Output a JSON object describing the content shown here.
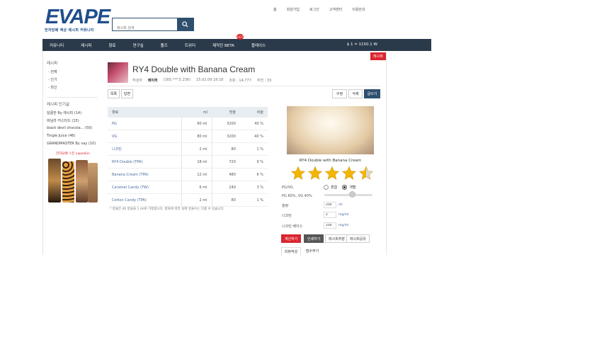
{
  "header": {
    "logo": "EVAPE",
    "logo_sub": "전자담배 액상 레시피 커뮤니티",
    "search_placeholder": "레시피 검색",
    "top_links": [
      "홈",
      "회원가입",
      "로그인",
      "고객센터",
      "이용안내"
    ]
  },
  "nav": {
    "items": [
      "커뮤니티",
      "레시피",
      "향료",
      "연구실",
      "툴즈",
      "트위터",
      "제작진 BETA",
      "플레이스"
    ],
    "hot_badge": "HOT",
    "right_text": "$ 1 = 1150.1 W"
  },
  "badge": "레시피",
  "sidebar": {
    "section1_title": "레시피",
    "section1_items": [
      "- 전체",
      "- 인기",
      "- 최신"
    ],
    "section2_title": "레시피 인기글",
    "section2_items": [
      "달콤한 By 레시피 (14)",
      "바닐라 커스터드 (15)",
      "black devil chocola... (50)",
      "Tingle Juice (46)",
      "GRANDMASTER By vay (10)"
    ],
    "ad_text": "전자담배 스킨 vapeskin"
  },
  "recipe": {
    "title": "RY4 Double with Banana Cream",
    "author_label": "작성자",
    "author": "베이퍼",
    "author_id": "(165.***.5.236)",
    "date": "15.02.09 18:18",
    "views": "조회 : 14,777",
    "recommend": "추천 : 33"
  },
  "buttons": {
    "list": "목록",
    "reply": "답변",
    "edit": "수정",
    "delete": "삭제",
    "write": "글쓰기"
  },
  "table": {
    "headers": [
      "향료",
      "ml",
      "방울",
      "비율"
    ],
    "rows": [
      [
        "PG",
        "80 ml",
        "3200",
        "40 %"
      ],
      [
        "VG",
        "80 ml",
        "3200",
        "40 %"
      ],
      [
        "니코틴",
        "2 ml",
        "80",
        "1 %"
      ],
      [
        "RY4 Double (TPA)",
        "18 ml",
        "720",
        "9 %"
      ],
      [
        "Banana Cream (TPA)",
        "12 ml",
        "480",
        "6 %"
      ],
      [
        "Caramel Candy (TW)",
        "6 ml",
        "240",
        "3 %"
      ],
      [
        "Cotton Candy (TPA)",
        "2 ml",
        "80",
        "1 %"
      ]
    ],
    "notice": "* 방울은 40 방울을 1 ml로 가정합니다. 향료에 따라 실제 방울수는 다를 수 있습니다."
  },
  "panel": {
    "photo_name": "RY4 Double with Banana Cream",
    "rating": 4.5,
    "pgvg_label": "PG/VG",
    "radio1": "혼합",
    "radio2": "개별",
    "pgvg_value": "PG 60%, VG 40%",
    "amount_label": "총량",
    "amount_value": "200",
    "amount_unit": "ml",
    "nic_label": "니코틴",
    "nic_value": "2",
    "nic_unit": "mg/ml",
    "nic_base_label": "니코틴 베이스",
    "nic_base_value": "100",
    "nic_base_unit": "mg/ml",
    "btn1": "계산하기",
    "btn2": "인쇄하기",
    "btn3": "레시피저장",
    "btn4": "레시피공유",
    "link1": "리뷰작성",
    "link2": "점수주기"
  },
  "colors": {
    "navbar": "#2b3a4a",
    "accent": "#2f4f6f",
    "red": "#d9262f",
    "star": "#f5b400"
  }
}
